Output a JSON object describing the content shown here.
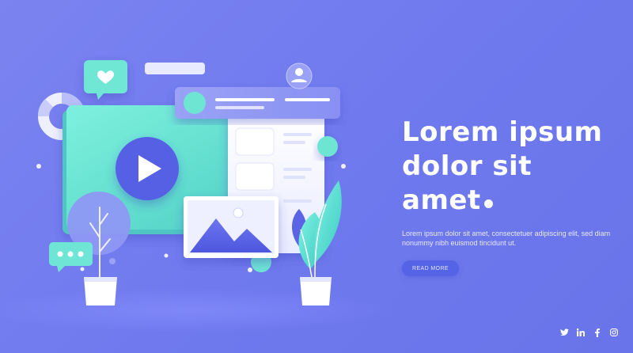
{
  "hero": {
    "title_lines": [
      "Lorem ipsum",
      "dolor sit",
      "amet"
    ],
    "description": "Lorem ipsum dolor sit amet, consectetuer adipiscing elit, sed diam nonummy nibh euismod tincidunt ut.",
    "button_label": "READ MORE"
  },
  "social": {
    "icons": [
      "twitter-icon",
      "linkedin-icon",
      "facebook-icon",
      "instagram-icon"
    ]
  },
  "colors": {
    "background": "#7079ee",
    "accent_teal": "#5ee0cf",
    "accent_indigo": "#5560e4",
    "button_bg": "#5563e6",
    "white": "#ffffff"
  },
  "illustration": {
    "icons": [
      "heart-icon",
      "user-icon",
      "play-icon",
      "image-icon",
      "chat-dots-icon",
      "plant-icon",
      "donut-icon"
    ]
  }
}
